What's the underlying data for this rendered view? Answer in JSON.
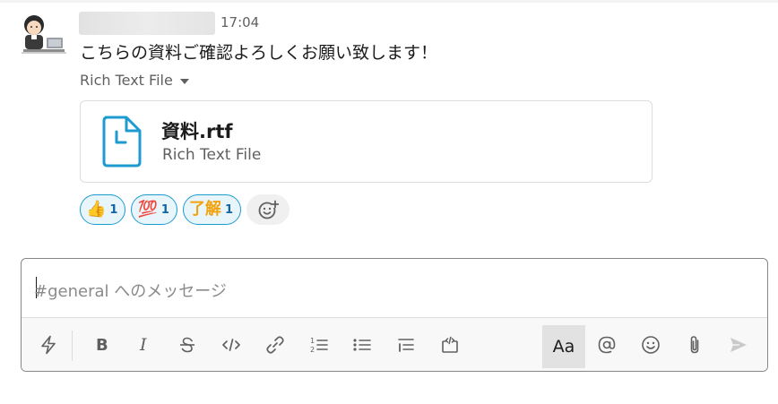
{
  "message": {
    "time": "17:04",
    "text": "こちらの資料ご確認よろしくお願い致します！",
    "file_type_label": "Rich Text File"
  },
  "file": {
    "name": "資料.rtf",
    "type": "Rich Text File",
    "icon": "document-icon"
  },
  "reactions": [
    {
      "emoji": "👍",
      "count": "1",
      "icon": "thumbs-up-icon"
    },
    {
      "emoji": "💯",
      "count": "1",
      "icon": "hundred-points-icon"
    },
    {
      "emoji": "了解",
      "count": "1",
      "icon": "ryokai-stamp-icon"
    }
  ],
  "composer": {
    "placeholder": "#general へのメッセージ",
    "format_label": "Aa"
  },
  "toolbar_icons": [
    "shortcuts-lightning-icon",
    "bold-icon",
    "italic-icon",
    "strikethrough-icon",
    "code-icon",
    "link-icon",
    "ordered-list-icon",
    "bulleted-list-icon",
    "blockquote-icon",
    "code-block-icon",
    "mention-icon",
    "emoji-icon",
    "attach-icon",
    "send-icon"
  ],
  "colors": {
    "reaction_border": "#1d9bd1",
    "reaction_bg": "#e8f5fa",
    "file_icon": "#1d9bd1",
    "format_active_bg": "#e2e2e2"
  }
}
